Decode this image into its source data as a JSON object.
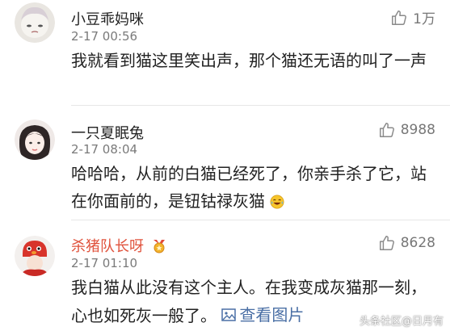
{
  "comments": [
    {
      "username": "小豆乖妈咪",
      "time": "2-17 00:56",
      "likes": "1万",
      "text": "我就看到猫这里笑出声，那个猫还无语的叫了一声"
    },
    {
      "username": "一只夏眠兔",
      "time": "2-17 08:04",
      "likes": "8988",
      "text": "哈哈哈，从前的白猫已经死了，你亲手杀了它，站在你面前的，是钮钴禄灰猫"
    },
    {
      "username": "杀猪队长呀",
      "time": "2-17 01:10",
      "likes": "8628",
      "text": "我白猫从此没有这个主人。在我变成灰猫那一刻，心也如死灰一般了。",
      "view_image": "查看图片"
    }
  ],
  "watermark": "头条社区@日月有",
  "icons": {
    "like": "thumbs-up-icon",
    "emoji": "laughing-crying-emoji-icon",
    "image": "image-icon",
    "badge": "medal-badge-icon"
  },
  "colors": {
    "accent_username": "#e0533d",
    "link": "#4a6fa5",
    "meta": "#7a7a7a"
  }
}
